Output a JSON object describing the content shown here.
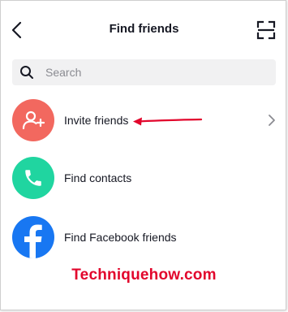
{
  "header": {
    "title": "Find friends",
    "back_icon": "chevron-left-icon",
    "scan_icon": "scan-icon"
  },
  "search": {
    "placeholder": "Search",
    "value": ""
  },
  "rows": [
    {
      "label": "Invite friends",
      "icon": "add-person-icon",
      "color": "#f2685f",
      "has_chevron": true
    },
    {
      "label": "Find contacts",
      "icon": "phone-icon",
      "color": "#20d5a0",
      "has_chevron": false
    },
    {
      "label": "Find Facebook friends",
      "icon": "facebook-icon",
      "color": "#1877f2",
      "has_chevron": false
    }
  ],
  "annotation": {
    "arrow_color": "#e2062c",
    "watermark": "Techniquehow.com"
  }
}
